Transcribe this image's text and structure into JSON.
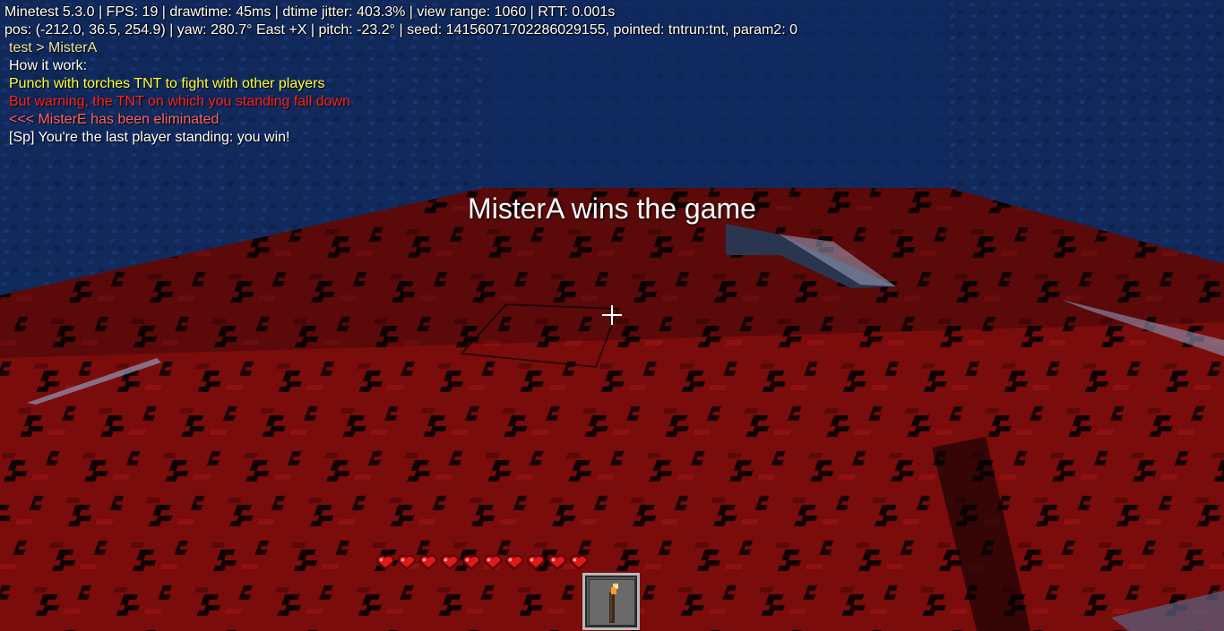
{
  "debug": {
    "line1": "Minetest 5.3.0 | FPS: 19 | drawtime: 45ms | dtime jitter: 403.3% | view range: 1060 | RTT: 0.001s",
    "line2": "pos: (-212.0, 36.5, 254.9) | yaw: 280.7° East +X | pitch: -23.2° | seed: 14156071702286029155, pointed: tntrun:tnt, param2: 0"
  },
  "chat": [
    {
      "text": "test > MisterA",
      "color": "#e8e4a0"
    },
    {
      "text": "How it work:",
      "color": "#ffffff"
    },
    {
      "text": "Punch with torches TNT to fight with other players",
      "color": "#ffff33"
    },
    {
      "text": "But warning, the TNT on which you standing fall down",
      "color": "#ff2020"
    },
    {
      "text": "<<< MisterE has been eliminated",
      "color": "#ff6060"
    },
    {
      "text": "[Sp] You're the last player standing: you win!",
      "color": "#ffffff"
    }
  ],
  "title_message": "MisterA wins the game",
  "health": {
    "hearts": 10,
    "max_hearts": 10
  },
  "hotbar": {
    "selected_item_icon": "torch-icon"
  },
  "floor_block_label": "TNT",
  "colors": {
    "sky": "#0d2452",
    "floor": "#6a0a0a",
    "heart": "#e01818"
  }
}
